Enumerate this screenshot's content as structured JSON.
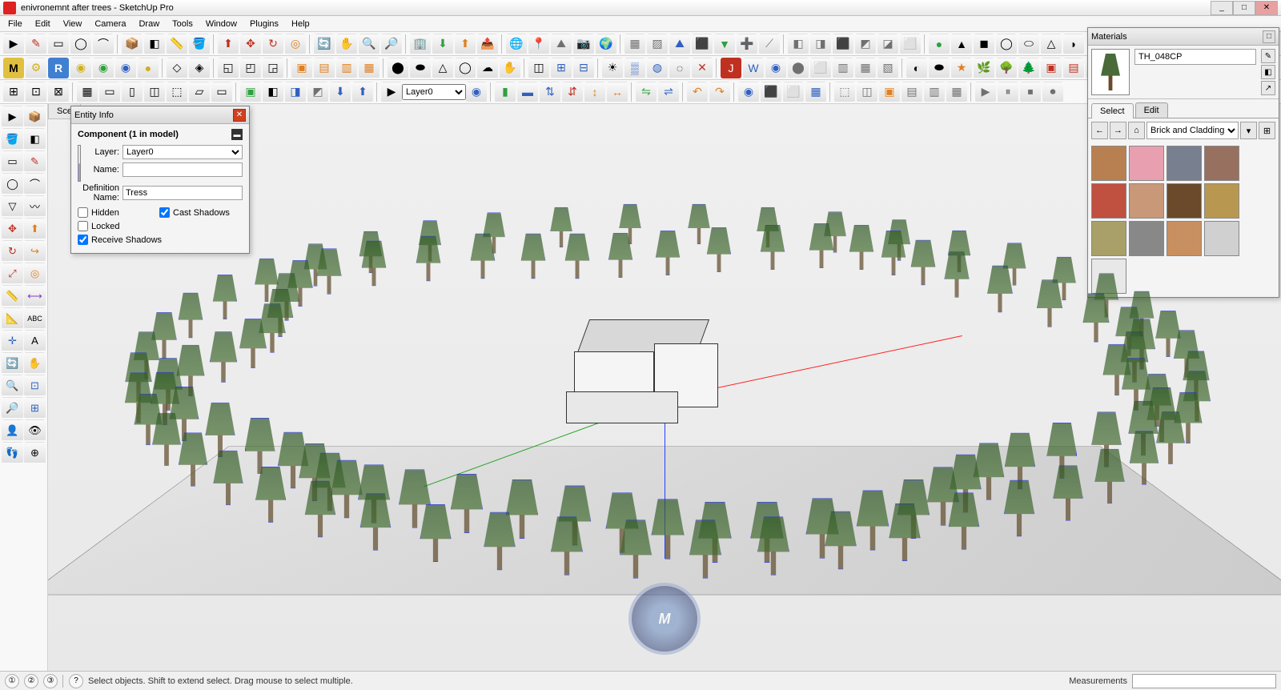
{
  "window": {
    "title": "enivronemnt after trees - SketchUp Pro",
    "minimize": "_",
    "maximize": "□",
    "close": "✕"
  },
  "menu": {
    "items": [
      "File",
      "Edit",
      "View",
      "Camera",
      "Draw",
      "Tools",
      "Window",
      "Plugins",
      "Help"
    ]
  },
  "toolbars": {
    "layer_selected": "Layer0"
  },
  "scene": {
    "tab": "Sce"
  },
  "entity_info": {
    "title": "Entity Info",
    "heading": "Component (1 in model)",
    "layer_label": "Layer:",
    "layer_value": "Layer0",
    "name_label": "Name:",
    "name_value": "",
    "defname_label": "Definition Name:",
    "defname_value": "Tress",
    "hidden_label": "Hidden",
    "hidden_checked": false,
    "locked_label": "Locked",
    "locked_checked": false,
    "cast_label": "Cast Shadows",
    "cast_checked": true,
    "receive_label": "Receive Shadows",
    "receive_checked": true
  },
  "materials": {
    "title": "Materials",
    "current_name": "TH_048CP",
    "tab_select": "Select",
    "tab_edit": "Edit",
    "category": "Brick and Cladding",
    "swatches": [
      "#b88050",
      "#e8a0b0",
      "#788090",
      "#987060",
      "#c05040",
      "#c89878",
      "#6a4a2a",
      "#b89850",
      "#a8a068",
      "#888888",
      "#c89060",
      "#d0d0d0",
      "#e8e8e8"
    ]
  },
  "status": {
    "hint": "Select objects. Shift to extend select. Drag mouse to select multiple.",
    "measurements_label": "Measurements",
    "measurements_value": ""
  },
  "icons": {
    "info": "?",
    "geo1": "①",
    "geo2": "②",
    "geo3": "③"
  }
}
